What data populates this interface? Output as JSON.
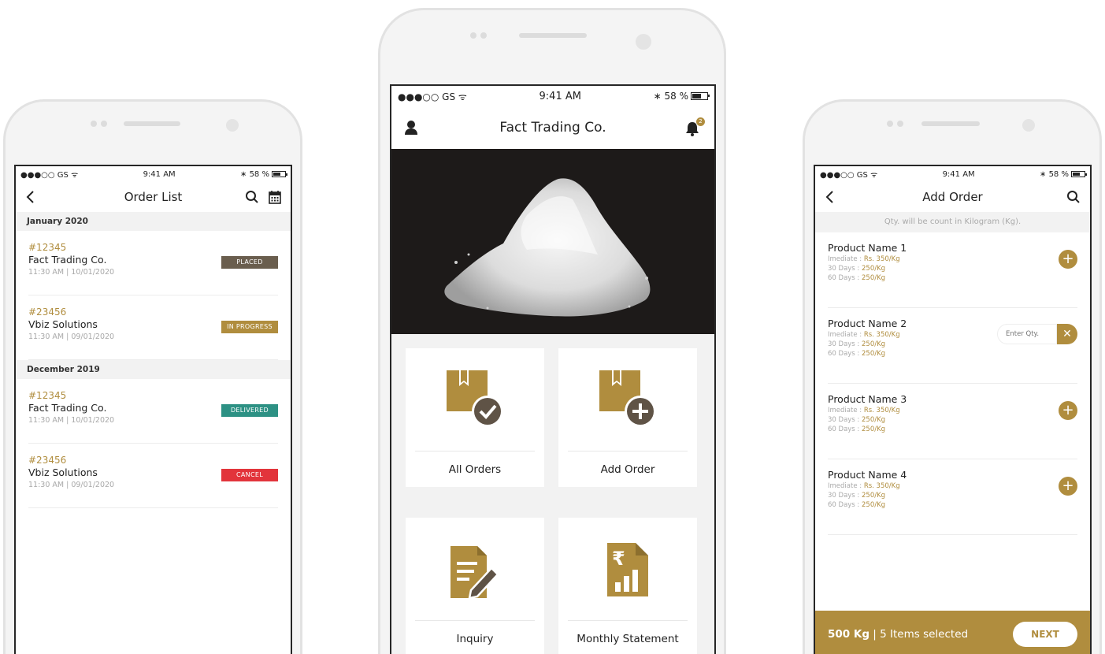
{
  "colors": {
    "accent": "#b08d3e",
    "placed": "#6a5e4e",
    "in_progress": "#b08d3e",
    "delivered": "#2d9184",
    "cancel": "#e2343b",
    "hero_bg": "#1d1a19"
  },
  "status_bar": {
    "carrier": "●●●○○ GS ᯤ",
    "time": "9:41 AM",
    "bt_battery": "∗ 58 %"
  },
  "order_list": {
    "title": "Order List",
    "sections": [
      {
        "label": "January 2020",
        "orders": [
          {
            "id": "#12345",
            "company": "Fact Trading Co.",
            "datetime": "11:30 AM | 10/01/2020",
            "status": "PLACED"
          },
          {
            "id": "#23456",
            "company": "Vbiz Solutions",
            "datetime": "11:30 AM | 09/01/2020",
            "status": "IN PROGRESS"
          }
        ]
      },
      {
        "label": "December 2019",
        "orders": [
          {
            "id": "#12345",
            "company": "Fact Trading Co.",
            "datetime": "11:30 AM | 10/01/2020",
            "status": "DELIVERED"
          },
          {
            "id": "#23456",
            "company": "Vbiz Solutions",
            "datetime": "11:30 AM | 09/01/2020",
            "status": "CANCEL"
          }
        ]
      }
    ]
  },
  "home": {
    "title": "Fact Trading Co.",
    "notification_count": "2",
    "tiles": [
      {
        "label": "All Orders",
        "icon": "box-check-icon"
      },
      {
        "label": "Add Order",
        "icon": "box-plus-icon"
      },
      {
        "label": "Inquiry",
        "icon": "document-edit-icon"
      },
      {
        "label": "Monthly Statement",
        "icon": "rupee-report-icon"
      }
    ]
  },
  "add_order": {
    "title": "Add Order",
    "hint": "Qty. will be count in Kilogram (Kg).",
    "products": [
      {
        "name": "Product Name 1",
        "immediate_label": "Imediate : ",
        "immediate_price": "Rs. 350/Kg",
        "d30_label": "30 Days : ",
        "d30_price": "250/Kg",
        "d60_label": "60 Days : ",
        "d60_price": "250/Kg"
      },
      {
        "name": "Product Name 2",
        "immediate_label": "Imediate : ",
        "immediate_price": "Rs. 350/Kg",
        "d30_label": "30 Days : ",
        "d30_price": "250/Kg",
        "d60_label": "60 Days : ",
        "d60_price": "250/Kg"
      },
      {
        "name": "Product Name 3",
        "immediate_label": "Imediate : ",
        "immediate_price": "Rs. 350/Kg",
        "d30_label": "30 Days : ",
        "d30_price": "250/Kg",
        "d60_label": "60 Days : ",
        "d60_price": "250/Kg"
      },
      {
        "name": "Product Name 4",
        "immediate_label": "Imediate : ",
        "immediate_price": "Rs. 350/Kg",
        "d30_label": "30 Days : ",
        "d30_price": "250/Kg",
        "d60_label": "60 Days : ",
        "d60_price": "250/Kg"
      }
    ],
    "qty_placeholder": "Enter Qty.",
    "total_weight": "500 Kg",
    "separator": " | ",
    "items_selected": "5 Items selected",
    "next_label": "NEXT"
  }
}
